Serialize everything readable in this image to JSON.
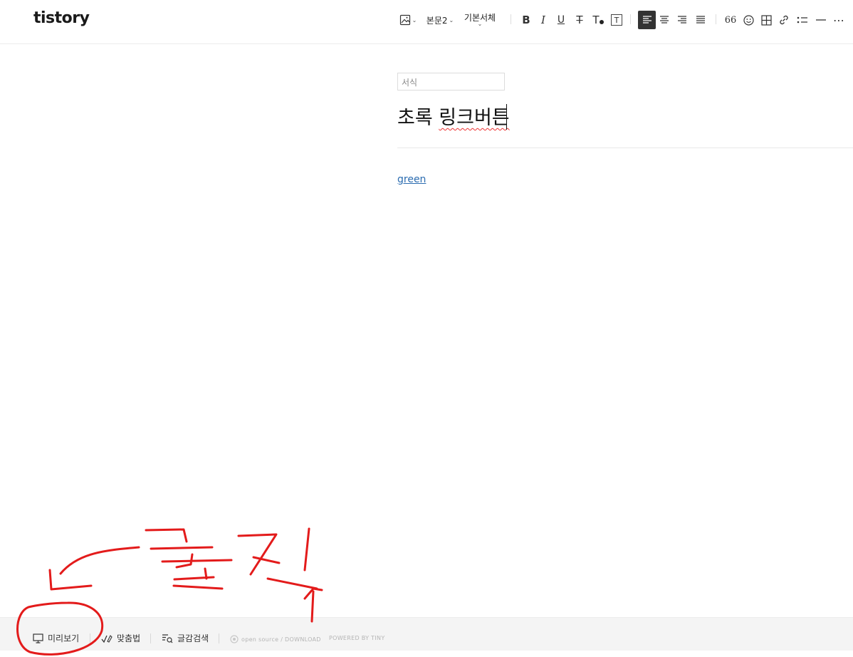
{
  "app": {
    "logo": "tistory"
  },
  "toolbar": {
    "paragraph_style": "본문2",
    "font_family": "기본서체",
    "bold_label": "B",
    "italic_label": "I",
    "underline_label": "U",
    "strike_label": "T",
    "text_color_label": "T",
    "bg_color_label": "T",
    "quote_label": "66",
    "more_label": "⋯"
  },
  "editor": {
    "format_placeholder": "서식",
    "title_plain": "초록 ",
    "title_squiggle": "링크버튼",
    "link_text": "green"
  },
  "footer": {
    "preview_label": "미리보기",
    "spellcheck_label": "맞춤법",
    "search_label": "글감검색",
    "opensource_label": "open source / DOWNLOAD",
    "powered_label": "POWERED BY TINY"
  },
  "annotation": {
    "color": "#e31b1b",
    "text": "클릭"
  },
  "colors": {
    "link": "#2b6cb0",
    "active_align_bg": "#333333"
  }
}
